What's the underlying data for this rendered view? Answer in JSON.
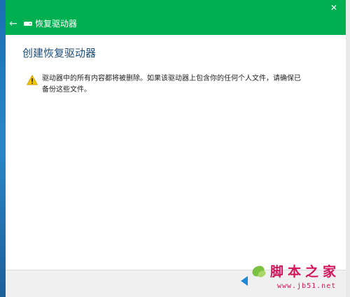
{
  "window": {
    "title": "恢复驱动器",
    "close_glyph": "✕",
    "back_glyph": "←"
  },
  "content": {
    "heading": "创建恢复驱动器",
    "warning": "驱动器中的所有内容都将被删除。如果该驱动器上包含你的任何个人文件，请确保已备份这些文件。"
  },
  "watermark": {
    "brand": "脚本之家",
    "url": "www.jb51.net"
  },
  "colors": {
    "titlebar": "#00b050",
    "heading": "#1f4e79",
    "warning_icon": "#f5c400",
    "watermark": "#d4145a"
  }
}
